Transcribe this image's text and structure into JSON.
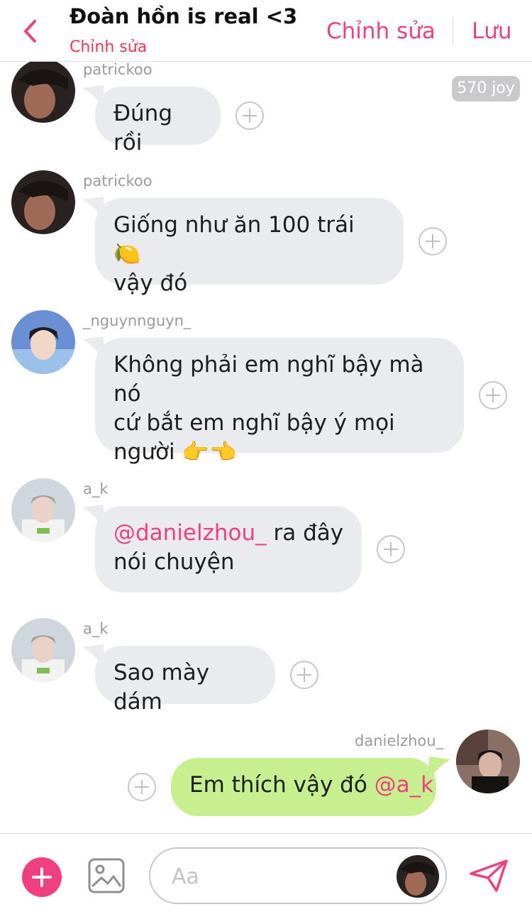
{
  "header": {
    "title": "Đoàn hồn is real <3",
    "subtitle": "Chỉnh sửa",
    "edit_label": "Chỉnh sửa",
    "save_label": "Lưu",
    "back_icon": "chevron-left-icon"
  },
  "badge": {
    "joy": "570 joy"
  },
  "messages": [
    {
      "user": "patrickoo",
      "text": "Đúng rồi",
      "direction": "incoming"
    },
    {
      "user": "patrickoo",
      "text_line1": "Giống như ăn 100 trái 🍋",
      "text_line2": "vậy đó",
      "direction": "incoming"
    },
    {
      "user": "_nguynnguyn_",
      "text_line1": "Không phải em nghĩ bậy mà nó",
      "text_line2": "cứ bắt em nghĩ bậy ý mọi",
      "text_line3": "người 👉👈",
      "direction": "incoming"
    },
    {
      "user": "a_k",
      "mention": "@danielzhou_",
      "text_after": " ra đây",
      "text_line2": "nói chuyện",
      "direction": "incoming"
    },
    {
      "user": "a_k",
      "text": "Sao mày dám",
      "direction": "incoming"
    },
    {
      "user": "danielzhou_",
      "text": "Em thích vậy đó ",
      "mention": "@a_k",
      "direction": "outgoing"
    }
  ],
  "composer": {
    "placeholder": "Aa",
    "value": "",
    "add_icon": "plus-circle-icon",
    "image_icon": "image-icon",
    "send_icon": "send-icon"
  },
  "colors": {
    "accent": "#f0407f",
    "incoming_bubble": "#e9ebee",
    "outgoing_bubble": "#c7ef8f",
    "subtitle": "#f0364f"
  }
}
